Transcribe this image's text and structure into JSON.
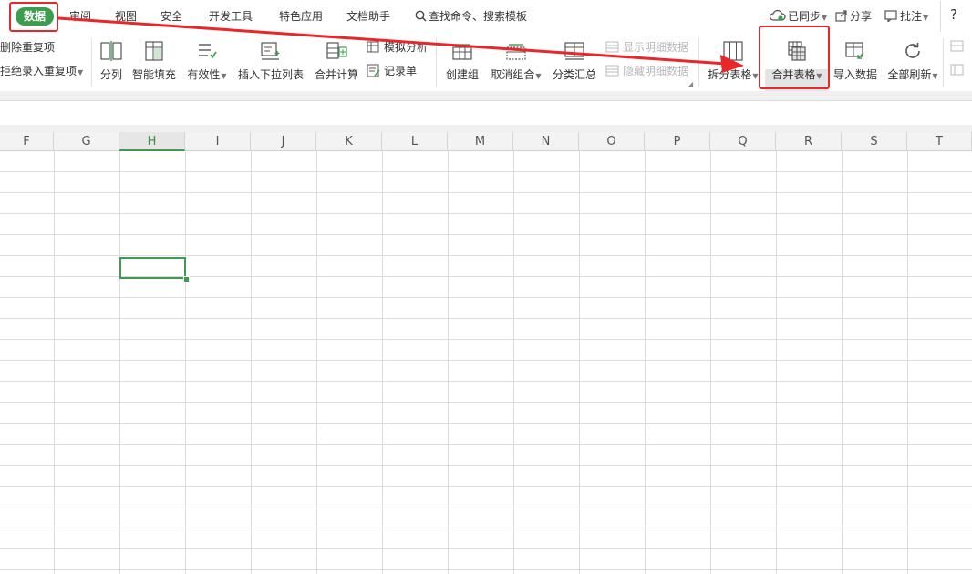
{
  "tabs": {
    "active": "数据",
    "items": [
      "审阅",
      "视图",
      "安全",
      "开发工具",
      "特色应用",
      "文档助手"
    ],
    "search": "查找命令、搜索模板"
  },
  "topright": {
    "sync": "已同步",
    "share": "分享",
    "comment": "批注",
    "help": "?"
  },
  "ribbon": {
    "remove_dup": "删除重复项",
    "reject_dup": "拒绝录入重复项",
    "split_col": "分列",
    "smart_fill": "智能填充",
    "validity": "有效性",
    "insert_dropdown": "插入下拉列表",
    "merge_calc": "合并计算",
    "simulate": "模拟分析",
    "record_form": "记录单",
    "create_group": "创建组",
    "ungroup": "取消组合",
    "subtotal": "分类汇总",
    "show_detail": "显示明细数据",
    "hide_detail": "隐藏明细数据",
    "split_table": "拆分表格",
    "merge_table": "合并表格",
    "import_data": "导入数据",
    "refresh_all": "全部刷新"
  },
  "columns": [
    "F",
    "G",
    "H",
    "I",
    "J",
    "K",
    "L",
    "M",
    "N",
    "O",
    "P",
    "Q",
    "R",
    "S",
    "T"
  ],
  "selected_column": "H",
  "colors": {
    "accent": "#3d9d4f",
    "annotation": "#e8272b"
  }
}
